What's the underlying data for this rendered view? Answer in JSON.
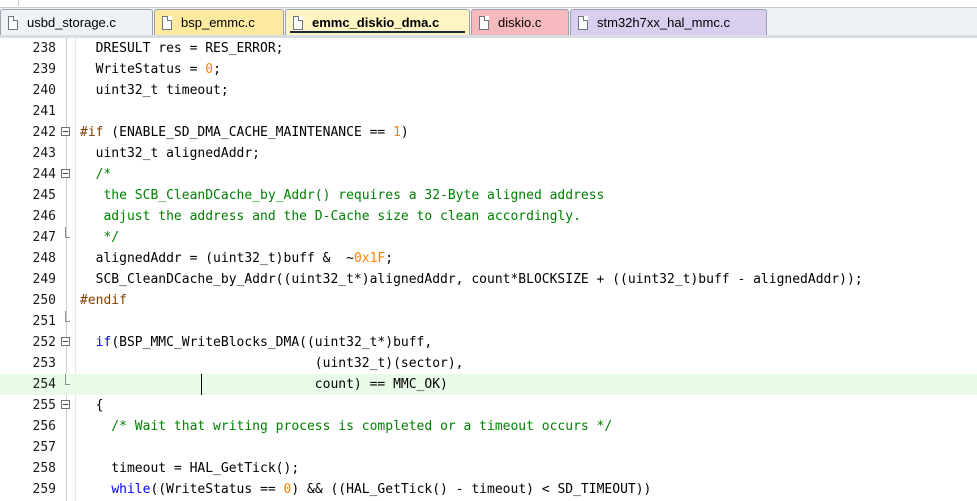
{
  "tabs": [
    {
      "label": "usbd_storage.c",
      "bg": "#eef1f5",
      "active": false
    },
    {
      "label": "bsp_emmc.c",
      "bg": "#fde9a0",
      "active": false
    },
    {
      "label": "emmc_diskio_dma.c",
      "bg": "#fff5c2",
      "active": true
    },
    {
      "label": "diskio.c",
      "bg": "#f6b9bd",
      "active": false
    },
    {
      "label": "stm32h7xx_hal_mmc.c",
      "bg": "#d9cdf0",
      "active": false
    }
  ],
  "colors": {
    "keyword": "#0000ff",
    "preprocessor": "#804000",
    "number": "#ff8000",
    "comment": "#008000",
    "current_line": "#e8fbe8"
  },
  "icons": {
    "file_tab": "file-icon",
    "fold": "fold-minus-icon"
  },
  "editor": {
    "current_line_number": "254",
    "lines": [
      {
        "num": "238",
        "text": "  DRESULT res = RES_ERROR;"
      },
      {
        "num": "239",
        "text": "  WriteStatus = 0;"
      },
      {
        "num": "240",
        "text": "  uint32_t timeout;"
      },
      {
        "num": "241",
        "text": ""
      },
      {
        "num": "242",
        "text": "#if (ENABLE_SD_DMA_CACHE_MAINTENANCE == 1)"
      },
      {
        "num": "243",
        "text": "  uint32_t alignedAddr;"
      },
      {
        "num": "244",
        "text": "  /*"
      },
      {
        "num": "245",
        "text": "   the SCB_CleanDCache_by_Addr() requires a 32-Byte aligned address"
      },
      {
        "num": "246",
        "text": "   adjust the address and the D-Cache size to clean accordingly."
      },
      {
        "num": "247",
        "text": "   */"
      },
      {
        "num": "248",
        "text": "  alignedAddr = (uint32_t)buff &  ~0x1F;"
      },
      {
        "num": "249",
        "text": "  SCB_CleanDCache_by_Addr((uint32_t*)alignedAddr, count*BLOCKSIZE + ((uint32_t)buff - alignedAddr));"
      },
      {
        "num": "250",
        "text": "#endif"
      },
      {
        "num": "251",
        "text": ""
      },
      {
        "num": "252",
        "text": "  if(BSP_MMC_WriteBlocks_DMA((uint32_t*)buff,"
      },
      {
        "num": "253",
        "text": "                              (uint32_t)(sector),"
      },
      {
        "num": "254",
        "text": "                              count) == MMC_OK)"
      },
      {
        "num": "255",
        "text": "  {"
      },
      {
        "num": "256",
        "text": "    /* Wait that writing process is completed or a timeout occurs */"
      },
      {
        "num": "257",
        "text": ""
      },
      {
        "num": "258",
        "text": "    timeout = HAL_GetTick();"
      },
      {
        "num": "259",
        "text": "    while((WriteStatus == 0) && ((HAL_GetTick() - timeout) < SD_TIMEOUT))"
      }
    ]
  }
}
